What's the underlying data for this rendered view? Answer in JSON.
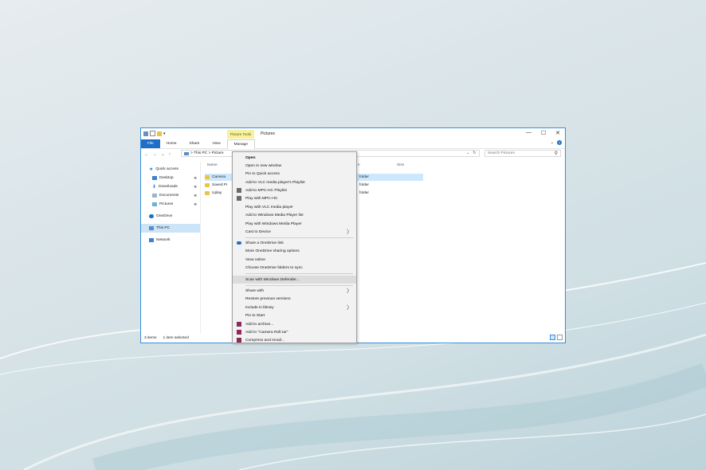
{
  "window": {
    "title": "Pictures",
    "context_tab": "Picture Tools",
    "controls": [
      "—",
      "☐",
      "✕"
    ]
  },
  "ribbon": {
    "tabs": [
      "File",
      "Home",
      "Share",
      "View",
      "Manage"
    ],
    "collapse": "⌄",
    "help": "?"
  },
  "address": {
    "path": "> This PC > Picture",
    "dropdown": "⌄",
    "refresh": "↻",
    "search_placeholder": "Search Pictures"
  },
  "nav": {
    "items": [
      {
        "label": "Quick access",
        "pinned": false
      },
      {
        "label": "Desktop",
        "pinned": true
      },
      {
        "label": "Downloads",
        "pinned": true
      },
      {
        "label": "Documents",
        "pinned": true
      },
      {
        "label": "Pictures",
        "pinned": true
      },
      {
        "label": "OneDrive",
        "pinned": false
      },
      {
        "label": "This PC",
        "pinned": false
      },
      {
        "label": "Network",
        "pinned": false
      }
    ],
    "pin_glyph": "✱"
  },
  "content": {
    "columns": {
      "name": "Name",
      "type": "e",
      "size": "Size"
    },
    "rows": [
      {
        "name": "Camera",
        "type": "folder"
      },
      {
        "name": "Saved Pi",
        "type": "folder"
      },
      {
        "name": "Uplay",
        "type": "folder"
      }
    ]
  },
  "status": {
    "items": "3 items",
    "selected": "1 item selected"
  },
  "context_menu": {
    "items": [
      {
        "label": "Open"
      },
      {
        "label": "Open in new window"
      },
      {
        "label": "Pin to Quick access"
      },
      {
        "label": "Add to VLC media player's Playlist"
      },
      {
        "label": "Add to MPC-HC Playlist"
      },
      {
        "label": "Play with MPC-HC"
      },
      {
        "label": "Play with VLC media player"
      },
      {
        "label": "Add to Windows Media Player list"
      },
      {
        "label": "Play with Windows Media Player"
      },
      {
        "label": "Cast to Device"
      },
      {
        "label": "Share a OneDrive link"
      },
      {
        "label": "More OneDrive sharing options"
      },
      {
        "label": "View online"
      },
      {
        "label": "Choose OneDrive folders to sync"
      },
      {
        "label": "Scan with Windows Defender..."
      },
      {
        "label": "Share with"
      },
      {
        "label": "Restore previous versions"
      },
      {
        "label": "Include in library"
      },
      {
        "label": "Pin to Start"
      },
      {
        "label": "Add to archive..."
      },
      {
        "label": "Add to \"Camera Roll.rar\""
      },
      {
        "label": "Compress and email..."
      }
    ],
    "submenu_arrow": "〉"
  },
  "colors": {
    "accent": "#1f6fc6",
    "selection": "#cce8ff",
    "highlight": "#dcdcdc",
    "folder": "#e9c44a"
  }
}
